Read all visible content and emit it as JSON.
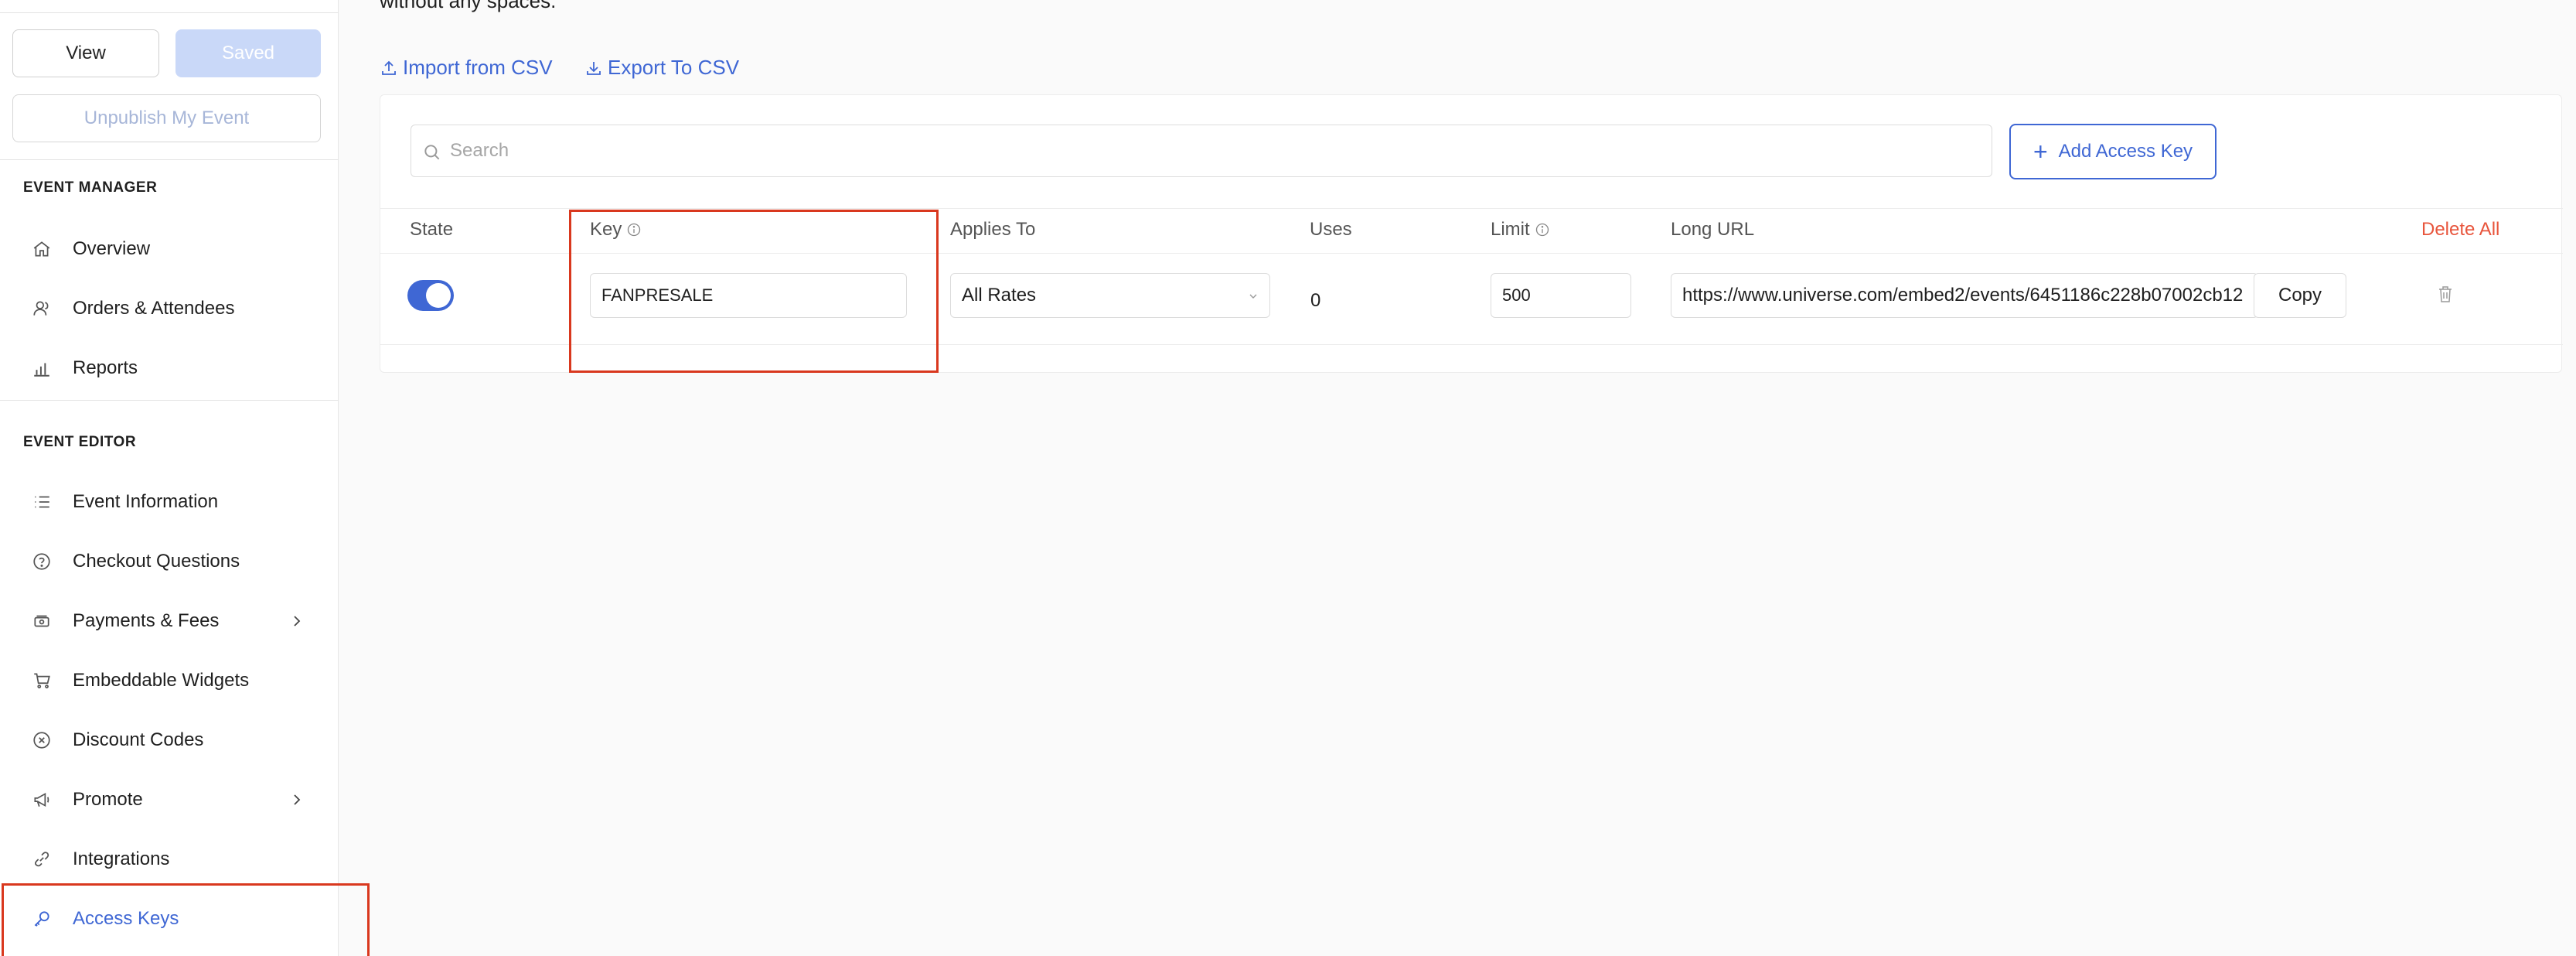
{
  "sidebar": {
    "view_label": "View",
    "saved_label": "Saved",
    "unpublish_label": "Unpublish My Event",
    "event_manager_title": "EVENT MANAGER",
    "event_editor_title": "EVENT EDITOR",
    "manager_items": [
      {
        "label": "Overview",
        "icon": "home-icon"
      },
      {
        "label": "Orders & Attendees",
        "icon": "users-icon"
      },
      {
        "label": "Reports",
        "icon": "bar-chart-icon"
      }
    ],
    "editor_items": [
      {
        "label": "Event Information",
        "icon": "list-icon"
      },
      {
        "label": "Checkout Questions",
        "icon": "question-circle-icon"
      },
      {
        "label": "Payments & Fees",
        "icon": "payments-icon",
        "has_submenu": true
      },
      {
        "label": "Embeddable Widgets",
        "icon": "cart-icon"
      },
      {
        "label": "Discount Codes",
        "icon": "discount-icon"
      },
      {
        "label": "Promote",
        "icon": "megaphone-icon",
        "has_submenu": true
      },
      {
        "label": "Integrations",
        "icon": "link-icon"
      },
      {
        "label": "Access Keys",
        "icon": "key-icon",
        "active": true
      }
    ]
  },
  "main": {
    "helper_text": "without any spaces.",
    "import_label": "Import from CSV",
    "export_label": "Export To CSV",
    "search_placeholder": "Search",
    "add_key_label": "Add Access Key",
    "columns": {
      "state": "State",
      "key": "Key",
      "applies_to": "Applies To",
      "uses": "Uses",
      "limit": "Limit",
      "long_url": "Long URL",
      "delete_all": "Delete All"
    },
    "row": {
      "state_enabled": true,
      "key": "FANPRESALE",
      "applies_to": "All Rates",
      "uses": "0",
      "limit": "500",
      "long_url": "https://www.universe.com/embed2/events/6451186c228b07002cb12",
      "copy_label": "Copy"
    }
  },
  "colors": {
    "accent": "#3f67d4",
    "highlight": "#d9381e",
    "danger": "#e8553c"
  }
}
